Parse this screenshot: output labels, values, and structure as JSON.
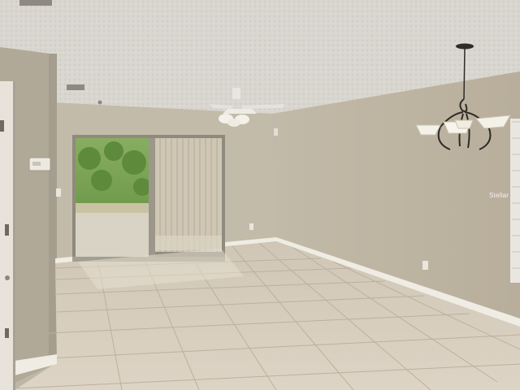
{
  "watermark": {
    "text": "Stellar"
  },
  "colors": {
    "ceiling": "#d8d6cf",
    "left_wall": "#b3ab9c",
    "back_wall": "#c3bba9",
    "right_wall": "#bfb6a3",
    "floor": "#d7cdbd",
    "grout": "#b9ae9b",
    "baseboard": "#efece4",
    "door_frame": "#8f8a7e",
    "outdoor_green": "#6f9a4a"
  }
}
